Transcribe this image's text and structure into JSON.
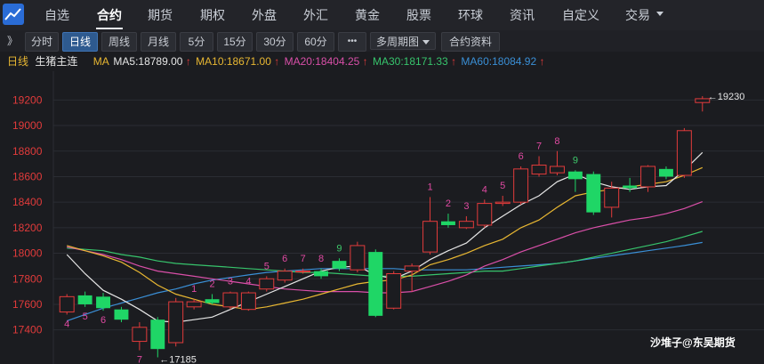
{
  "nav": {
    "items": [
      "自选",
      "合约",
      "期货",
      "期权",
      "外盘",
      "外汇",
      "黄金",
      "股票",
      "环球",
      "资讯",
      "自定义",
      "交易"
    ],
    "active": "合约",
    "dropdown_icon": "chevron-down-icon"
  },
  "toolbar": {
    "expand_glyph": "》",
    "periods": [
      "分时",
      "日线",
      "周线",
      "月线",
      "5分",
      "15分",
      "30分",
      "60分"
    ],
    "active_period": "日线",
    "more_glyph": "•••",
    "multi_period": "多周期图",
    "contract_info": "合约资料"
  },
  "legend": {
    "period": "日线",
    "contract": "生猪主连",
    "ma_title": "MA",
    "ma5": "MA5:18789.00",
    "ma10": "MA10:18671.00",
    "ma20": "MA20:18404.25",
    "ma30": "MA30:18171.33",
    "ma60": "MA60:18084.92",
    "up_arrow": "↑"
  },
  "watermark": "沙堆子@东吴期货",
  "colors": {
    "up": "#e23b3b",
    "down": "#1fd666",
    "ma5": "#e6e6e6",
    "ma10": "#e8b732",
    "ma20": "#d94fa8",
    "ma30": "#37c46c",
    "ma60": "#3a8fd6",
    "axis_text": "#e23b3b",
    "count_text": "#e04aa2",
    "nine": "#3ec96b"
  },
  "chart_data": {
    "type": "candlestick",
    "y_axis_labels": [
      "19200",
      "19000",
      "18800",
      "18600",
      "18400",
      "18200",
      "18000",
      "17800",
      "17600",
      "17400"
    ],
    "ylim": [
      17300,
      19300
    ],
    "annotations": {
      "high": "19230",
      "low": "17185"
    },
    "candles": [
      {
        "o": 17540,
        "c": 17660,
        "h": 17680,
        "l": 17520,
        "cnt": "4"
      },
      {
        "o": 17670,
        "c": 17600,
        "h": 17700,
        "l": 17580,
        "cnt": "5"
      },
      {
        "o": 17660,
        "c": 17570,
        "h": 17690,
        "l": 17550,
        "cnt": "6"
      },
      {
        "o": 17560,
        "c": 17480,
        "h": 17580,
        "l": 17460,
        "cnt": ""
      },
      {
        "o": 17310,
        "c": 17420,
        "h": 17460,
        "l": 17240,
        "cnt": "7"
      },
      {
        "o": 17480,
        "c": 17250,
        "h": 17500,
        "l": 17185,
        "cnt": ""
      },
      {
        "o": 17300,
        "c": 17620,
        "h": 17650,
        "l": 17270,
        "cnt": ""
      },
      {
        "o": 17580,
        "c": 17620,
        "h": 17640,
        "l": 17560,
        "cnt": "1"
      },
      {
        "o": 17640,
        "c": 17610,
        "h": 17680,
        "l": 17600,
        "cnt": "2"
      },
      {
        "o": 17580,
        "c": 17690,
        "h": 17700,
        "l": 17560,
        "cnt": "3"
      },
      {
        "o": 17560,
        "c": 17690,
        "h": 17700,
        "l": 17550,
        "cnt": "4"
      },
      {
        "o": 17720,
        "c": 17800,
        "h": 17820,
        "l": 17700,
        "cnt": "5"
      },
      {
        "o": 17790,
        "c": 17860,
        "h": 17880,
        "l": 17770,
        "cnt": "6"
      },
      {
        "o": 17860,
        "c": 17860,
        "h": 17880,
        "l": 17840,
        "cnt": "7"
      },
      {
        "o": 17860,
        "c": 17820,
        "h": 17880,
        "l": 17800,
        "cnt": "8"
      },
      {
        "o": 17940,
        "c": 17880,
        "h": 17960,
        "l": 17860,
        "cnt": "9"
      },
      {
        "o": 17870,
        "c": 18060,
        "h": 18090,
        "l": 17850,
        "cnt": ""
      },
      {
        "o": 18010,
        "c": 17510,
        "h": 18030,
        "l": 17500,
        "cnt": ""
      },
      {
        "o": 17570,
        "c": 17840,
        "h": 17860,
        "l": 17560,
        "cnt": ""
      },
      {
        "o": 17860,
        "c": 17900,
        "h": 17920,
        "l": 17700,
        "cnt": ""
      },
      {
        "o": 18010,
        "c": 18250,
        "h": 18440,
        "l": 17990,
        "cnt": "1"
      },
      {
        "o": 18250,
        "c": 18220,
        "h": 18310,
        "l": 18200,
        "cnt": "2"
      },
      {
        "o": 18200,
        "c": 18250,
        "h": 18290,
        "l": 18190,
        "cnt": "3"
      },
      {
        "o": 18220,
        "c": 18390,
        "h": 18420,
        "l": 18200,
        "cnt": "4"
      },
      {
        "o": 18390,
        "c": 18400,
        "h": 18450,
        "l": 18370,
        "cnt": "5"
      },
      {
        "o": 18400,
        "c": 18660,
        "h": 18680,
        "l": 18380,
        "cnt": "6"
      },
      {
        "o": 18620,
        "c": 18690,
        "h": 18760,
        "l": 18600,
        "cnt": "7"
      },
      {
        "o": 18630,
        "c": 18680,
        "h": 18800,
        "l": 18610,
        "cnt": "8"
      },
      {
        "o": 18640,
        "c": 18580,
        "h": 18650,
        "l": 18480,
        "cnt": "9"
      },
      {
        "o": 18620,
        "c": 18320,
        "h": 18640,
        "l": 18300,
        "cnt": ""
      },
      {
        "o": 18360,
        "c": 18510,
        "h": 18560,
        "l": 18280,
        "cnt": ""
      },
      {
        "o": 18530,
        "c": 18510,
        "h": 18590,
        "l": 18480,
        "cnt": ""
      },
      {
        "o": 18520,
        "c": 18680,
        "h": 18690,
        "l": 18480,
        "cnt": ""
      },
      {
        "o": 18660,
        "c": 18600,
        "h": 18680,
        "l": 18580,
        "cnt": ""
      },
      {
        "o": 18610,
        "c": 18960,
        "h": 18980,
        "l": 18590,
        "cnt": ""
      },
      {
        "o": 19180,
        "c": 19210,
        "h": 19230,
        "l": 19110,
        "cnt": ""
      }
    ],
    "ma_lines": {
      "ma5": [
        17990,
        17840,
        17710,
        17640,
        17560,
        17470,
        17460,
        17480,
        17500,
        17560,
        17620,
        17680,
        17740,
        17800,
        17860,
        17890,
        17900,
        17830,
        17800,
        17860,
        17950,
        18020,
        18080,
        18200,
        18290,
        18380,
        18450,
        18560,
        18620,
        18560,
        18520,
        18500,
        18520,
        18530,
        18650,
        18789
      ],
      "ma10": [
        18060,
        18020,
        17980,
        17930,
        17850,
        17750,
        17680,
        17640,
        17600,
        17580,
        17560,
        17580,
        17610,
        17640,
        17680,
        17720,
        17760,
        17780,
        17790,
        17830,
        17910,
        17950,
        18000,
        18060,
        18110,
        18200,
        18260,
        18360,
        18450,
        18480,
        18500,
        18520,
        18540,
        18560,
        18610,
        18671
      ],
      "ma20": [
        18050,
        18020,
        17990,
        17950,
        17900,
        17860,
        17840,
        17820,
        17800,
        17780,
        17760,
        17740,
        17720,
        17710,
        17700,
        17700,
        17700,
        17690,
        17690,
        17700,
        17740,
        17780,
        17830,
        17900,
        17950,
        18010,
        18060,
        18110,
        18160,
        18200,
        18230,
        18260,
        18280,
        18310,
        18350,
        18404
      ],
      "ma30": [
        18040,
        18030,
        18020,
        17990,
        17970,
        17940,
        17920,
        17910,
        17900,
        17890,
        17880,
        17870,
        17860,
        17850,
        17850,
        17840,
        17830,
        17820,
        17820,
        17820,
        17830,
        17840,
        17850,
        17860,
        17860,
        17880,
        17900,
        17920,
        17940,
        17970,
        18000,
        18030,
        18060,
        18090,
        18130,
        18171
      ],
      "ma60": [
        17470,
        17520,
        17570,
        17610,
        17650,
        17690,
        17720,
        17760,
        17790,
        17810,
        17830,
        17850,
        17860,
        17870,
        17880,
        17880,
        17880,
        17880,
        17880,
        17870,
        17870,
        17870,
        17870,
        17880,
        17890,
        17900,
        17910,
        17920,
        17940,
        17960,
        17980,
        18000,
        18020,
        18040,
        18060,
        18085
      ]
    }
  }
}
